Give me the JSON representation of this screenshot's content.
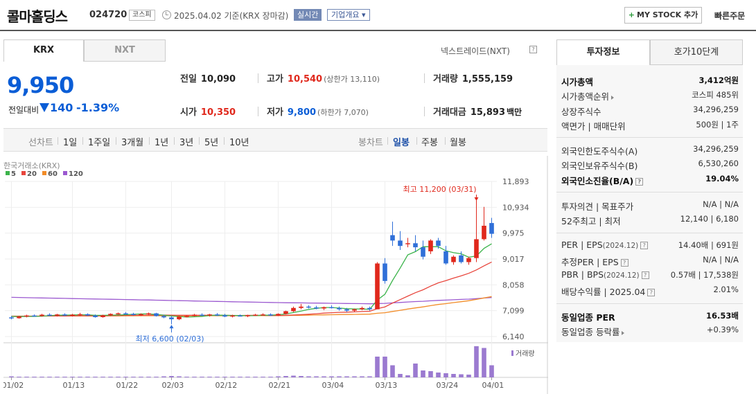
{
  "header": {
    "company_name": "콜마홀딩스",
    "stock_code": "024720",
    "market": "코스피",
    "basis": "2025.04.02  기준(KRX 장마감)",
    "realtime": "실시간",
    "overview": "기업개요 ▾",
    "mystock": "MY STOCK 추가",
    "mystock_plus": "+",
    "quick_order": "빠른주문"
  },
  "tabs": {
    "krx": "KRX",
    "nxt": "NXT",
    "nxt_trade": "넥스트레이드(NXT)"
  },
  "price": {
    "current": "9,950",
    "change_label": "전일대비",
    "change_amount": "140",
    "change_pct": "-1.39%"
  },
  "quote": {
    "prev_label": "전일",
    "prev": "10,090",
    "high_label": "고가",
    "high": "10,540",
    "upper_limit": "(상한가 13,110)",
    "volume_label": "거래량",
    "volume": "1,555,159",
    "open_label": "시가",
    "open": "10,350",
    "low_label": "저가",
    "low": "9,800",
    "lower_limit": "(하한가 7,070)",
    "amount_label": "거래대금",
    "amount": "15,893",
    "amount_unit": "백만"
  },
  "toolbar": {
    "line_label": "선차트",
    "line_periods": [
      "1일",
      "1주일",
      "3개월",
      "1년",
      "3년",
      "5년",
      "10년"
    ],
    "candle_label": "봉차트",
    "candle_periods": [
      "일봉",
      "주봉",
      "월봉"
    ],
    "candle_active": "일봉"
  },
  "chart_data": {
    "type": "candlestick",
    "source_label": "한국거래소(KRX)",
    "ma_legend": [
      {
        "name": "5",
        "color": "#3cb44b"
      },
      {
        "name": "20",
        "color": "#e8453c"
      },
      {
        "name": "60",
        "color": "#f28c28"
      },
      {
        "name": "120",
        "color": "#9b59d0"
      }
    ],
    "y_ticks": [
      "11,893",
      "10,934",
      "9,975",
      "9,017",
      "8,058",
      "7,099",
      "6,140"
    ],
    "ylim": [
      6140,
      11893
    ],
    "x_ticks": [
      "01/02",
      "01/13",
      "01/22",
      "02/03",
      "02/12",
      "02/21",
      "03/04",
      "03/13",
      "03/24",
      "04/01"
    ],
    "high_annotation": "최고 11,200 (03/31)",
    "low_annotation": "최저 6,600 (02/03)",
    "volume_label": "거래량",
    "up_color": "#e0281c",
    "down_color": "#2f6fd8",
    "candles": [
      [
        6850,
        6900,
        6780,
        6820
      ],
      [
        6820,
        6900,
        6800,
        6880
      ],
      [
        6880,
        6950,
        6850,
        6920
      ],
      [
        6920,
        6960,
        6880,
        6900
      ],
      [
        6900,
        6980,
        6880,
        6950
      ],
      [
        6950,
        7000,
        6900,
        6920
      ],
      [
        6920,
        6980,
        6880,
        6960
      ],
      [
        6960,
        7000,
        6900,
        6930
      ],
      [
        6930,
        6980,
        6880,
        6950
      ],
      [
        6950,
        7020,
        6900,
        6970
      ],
      [
        6970,
        7000,
        6900,
        6920
      ],
      [
        6920,
        6960,
        6840,
        6860
      ],
      [
        6860,
        6950,
        6840,
        6930
      ],
      [
        6930,
        7000,
        6900,
        6980
      ],
      [
        6980,
        7030,
        6950,
        7000
      ],
      [
        7000,
        7050,
        6950,
        6980
      ],
      [
        6980,
        7020,
        6920,
        6950
      ],
      [
        6950,
        7000,
        6900,
        6970
      ],
      [
        6970,
        7030,
        6940,
        7000
      ],
      [
        7000,
        7020,
        6880,
        6900
      ],
      [
        6900,
        6950,
        6820,
        6850
      ],
      [
        6850,
        6900,
        6600,
        6780
      ],
      [
        6780,
        6900,
        6750,
        6880
      ],
      [
        6880,
        6930,
        6850,
        6900
      ],
      [
        6900,
        6980,
        6880,
        6950
      ],
      [
        6950,
        7000,
        6900,
        6920
      ],
      [
        6920,
        6980,
        6880,
        6960
      ],
      [
        6960,
        7010,
        6900,
        6930
      ],
      [
        6930,
        6980,
        6860,
        6880
      ],
      [
        6880,
        6950,
        6850,
        6920
      ],
      [
        6920,
        6960,
        6880,
        6900
      ],
      [
        6900,
        6950,
        6860,
        6930
      ],
      [
        6930,
        6980,
        6900,
        6950
      ],
      [
        6950,
        7000,
        6920,
        6960
      ],
      [
        6960,
        7000,
        6900,
        6920
      ],
      [
        6920,
        7000,
        6900,
        6980
      ],
      [
        6980,
        7100,
        6960,
        7080
      ],
      [
        7080,
        7250,
        7050,
        7200
      ],
      [
        7200,
        7350,
        7150,
        7250
      ],
      [
        7250,
        7300,
        7180,
        7220
      ],
      [
        7220,
        7280,
        7150,
        7180
      ],
      [
        7180,
        7250,
        7120,
        7230
      ],
      [
        7230,
        7300,
        7180,
        7200
      ],
      [
        7200,
        7250,
        7100,
        7150
      ],
      [
        7150,
        7200,
        7050,
        7100
      ],
      [
        7100,
        7180,
        7050,
        7150
      ],
      [
        7150,
        7250,
        7120,
        7200
      ],
      [
        7200,
        7250,
        7100,
        7150
      ],
      [
        7150,
        8900,
        7150,
        8850
      ],
      [
        8850,
        9050,
        8100,
        8200
      ],
      [
        9900,
        10400,
        9500,
        9700
      ],
      [
        9700,
        10050,
        9350,
        9500
      ],
      [
        9600,
        9800,
        9450,
        9600
      ],
      [
        9600,
        9900,
        9300,
        9450
      ],
      [
        9450,
        9700,
        9000,
        9100
      ],
      [
        9300,
        9750,
        9200,
        9700
      ],
      [
        9700,
        9800,
        9400,
        9500
      ],
      [
        9300,
        9500,
        8800,
        8850
      ],
      [
        8900,
        9150,
        8800,
        9100
      ],
      [
        9150,
        9300,
        8850,
        8900
      ],
      [
        8900,
        9100,
        8800,
        9050
      ],
      [
        9050,
        11200,
        8900,
        9750
      ],
      [
        9750,
        10950,
        9700,
        10250
      ],
      [
        10350,
        10540,
        9800,
        9950
      ]
    ],
    "volumes": [
      3,
      2,
      2,
      2,
      2,
      2,
      2,
      2,
      2,
      2,
      2,
      2,
      2,
      2,
      2,
      2,
      2,
      2,
      2,
      2,
      3,
      4,
      3,
      2,
      2,
      2,
      2,
      2,
      2,
      2,
      2,
      2,
      2,
      2,
      2,
      3,
      4,
      5,
      4,
      3,
      3,
      3,
      3,
      3,
      3,
      3,
      3,
      3,
      60,
      60,
      35,
      10,
      6,
      40,
      20,
      18,
      14,
      12,
      10,
      9,
      8,
      90,
      85,
      35
    ]
  },
  "right_tabs": {
    "info": "투자정보",
    "hoga": "호가10단계"
  },
  "invest": {
    "market_cap_label": "시가총액",
    "market_cap": "3,412억원",
    "rank_label": "시가총액순위",
    "rank": "코스피 485위",
    "shares_label": "상장주식수",
    "shares": "34,296,259",
    "par_label": "액면가 | 매매단위",
    "par": "500원 | 1주",
    "foreign_limit_label": "외국인한도주식수(A)",
    "foreign_limit": "34,296,259",
    "foreign_hold_label": "외국인보유주식수(B)",
    "foreign_hold": "6,530,260",
    "foreign_ratio_label": "외국인소진율(B/A)",
    "foreign_ratio": "19.04%",
    "opinion_label": "투자의견 | 목표주가",
    "opinion": "N/A | N/A",
    "w52_label": "52주최고 | 최저",
    "w52": "12,140 | 6,180",
    "per_label": "PER | EPS",
    "per_sub": "(2024.12)",
    "per": "14.40배 | 691원",
    "est_per_label": "추정PER | EPS",
    "est_per": "N/A | N/A",
    "pbr_label": "PBR | BPS",
    "pbr_sub": "(2024.12)",
    "pbr": "0.57배 | 17,538원",
    "div_label": "배당수익률 | 2025.04",
    "div": "2.01%",
    "ind_per_label": "동일업종 PER",
    "ind_per": "16.53배",
    "ind_rate_label": "동일업종 등락률",
    "ind_rate": "+0.39%"
  }
}
